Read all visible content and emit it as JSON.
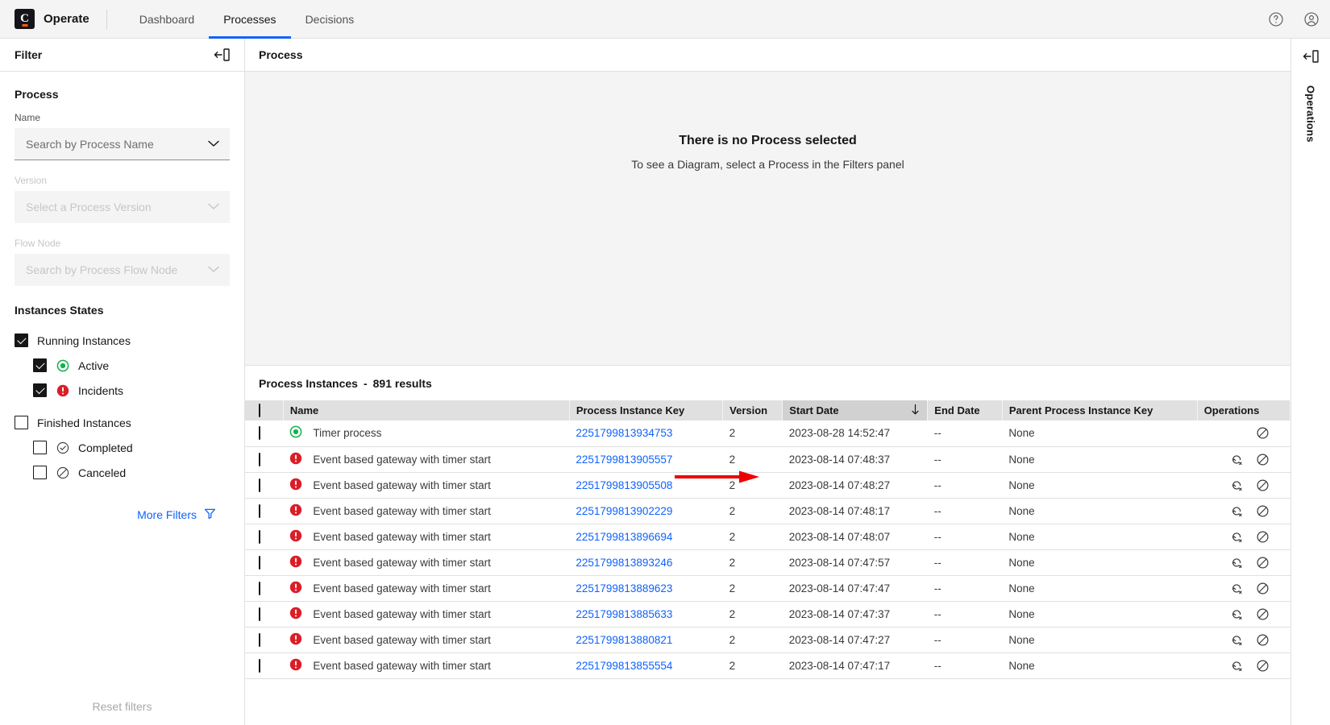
{
  "header": {
    "brand_letter": "C",
    "brand_name": "Operate",
    "nav": [
      {
        "label": "Dashboard",
        "active": false
      },
      {
        "label": "Processes",
        "active": true
      },
      {
        "label": "Decisions",
        "active": false
      }
    ],
    "help_icon": "help-icon",
    "user_icon": "user-avatar-icon"
  },
  "filter_panel": {
    "title": "Filter",
    "collapse_icon": "collapse-panel-icon",
    "process_section": "Process",
    "name_label": "Name",
    "name_placeholder": "Search by Process Name",
    "version_label": "Version",
    "version_placeholder": "Select a Process Version",
    "flow_node_label": "Flow Node",
    "flow_node_placeholder": "Search by Process Flow Node",
    "states_title": "Instances States",
    "states": [
      {
        "label": "Running Instances",
        "checked": true,
        "indent": false,
        "icon": "none"
      },
      {
        "label": "Active",
        "checked": true,
        "indent": true,
        "icon": "active-icon"
      },
      {
        "label": "Incidents",
        "checked": true,
        "indent": true,
        "icon": "incident-icon"
      },
      {
        "label": "Finished Instances",
        "checked": false,
        "indent": false,
        "icon": "none"
      },
      {
        "label": "Completed",
        "checked": false,
        "indent": true,
        "icon": "completed-icon"
      },
      {
        "label": "Canceled",
        "checked": false,
        "indent": true,
        "icon": "canceled-icon"
      }
    ],
    "more_filters": "More Filters",
    "more_filters_icon": "filter-funnel-icon",
    "reset_filters": "Reset filters"
  },
  "process_panel": {
    "title": "Process",
    "empty_title": "There is no Process selected",
    "empty_subtitle": "To see a Diagram, select a Process in the Filters panel"
  },
  "instances": {
    "title": "Process Instances",
    "separator": "-",
    "results": "891 results",
    "columns": [
      {
        "key": "check",
        "label": ""
      },
      {
        "key": "name",
        "label": "Name"
      },
      {
        "key": "processInstanceKey",
        "label": "Process Instance Key"
      },
      {
        "key": "version",
        "label": "Version"
      },
      {
        "key": "startDate",
        "label": "Start Date",
        "sorted": true,
        "sort_dir": "desc"
      },
      {
        "key": "endDate",
        "label": "End Date"
      },
      {
        "key": "parentKey",
        "label": "Parent Process Instance Key"
      },
      {
        "key": "operations",
        "label": "Operations"
      }
    ],
    "rows": [
      {
        "state": "active",
        "name": "Timer process",
        "key": "2251799813934753",
        "version": "2",
        "start": "2023-08-28 14:52:47",
        "end": "--",
        "parent": "None",
        "ops": [
          "cancel"
        ]
      },
      {
        "state": "incident",
        "name": "Event based gateway with timer start",
        "key": "2251799813905557",
        "version": "2",
        "start": "2023-08-14 07:48:37",
        "end": "--",
        "parent": "None",
        "ops": [
          "retry",
          "cancel"
        ]
      },
      {
        "state": "incident",
        "name": "Event based gateway with timer start",
        "key": "2251799813905508",
        "version": "2",
        "start": "2023-08-14 07:48:27",
        "end": "--",
        "parent": "None",
        "ops": [
          "retry",
          "cancel"
        ]
      },
      {
        "state": "incident",
        "name": "Event based gateway with timer start",
        "key": "2251799813902229",
        "version": "2",
        "start": "2023-08-14 07:48:17",
        "end": "--",
        "parent": "None",
        "ops": [
          "retry",
          "cancel"
        ]
      },
      {
        "state": "incident",
        "name": "Event based gateway with timer start",
        "key": "2251799813896694",
        "version": "2",
        "start": "2023-08-14 07:48:07",
        "end": "--",
        "parent": "None",
        "ops": [
          "retry",
          "cancel"
        ]
      },
      {
        "state": "incident",
        "name": "Event based gateway with timer start",
        "key": "2251799813893246",
        "version": "2",
        "start": "2023-08-14 07:47:57",
        "end": "--",
        "parent": "None",
        "ops": [
          "retry",
          "cancel"
        ]
      },
      {
        "state": "incident",
        "name": "Event based gateway with timer start",
        "key": "2251799813889623",
        "version": "2",
        "start": "2023-08-14 07:47:47",
        "end": "--",
        "parent": "None",
        "ops": [
          "retry",
          "cancel"
        ]
      },
      {
        "state": "incident",
        "name": "Event based gateway with timer start",
        "key": "2251799813885633",
        "version": "2",
        "start": "2023-08-14 07:47:37",
        "end": "--",
        "parent": "None",
        "ops": [
          "retry",
          "cancel"
        ]
      },
      {
        "state": "incident",
        "name": "Event based gateway with timer start",
        "key": "2251799813880821",
        "version": "2",
        "start": "2023-08-14 07:47:27",
        "end": "--",
        "parent": "None",
        "ops": [
          "retry",
          "cancel"
        ]
      },
      {
        "state": "incident",
        "name": "Event based gateway with timer start",
        "key": "2251799813855554",
        "version": "2",
        "start": "2023-08-14 07:47:17",
        "end": "--",
        "parent": "None",
        "ops": [
          "retry",
          "cancel"
        ]
      }
    ]
  },
  "right_rail": {
    "collapse_icon": "collapse-panel-icon",
    "label": "Operations"
  },
  "annotation": {
    "type": "arrow",
    "color": "#ef0000",
    "points_to": "first-row-process-instance-key"
  },
  "colors": {
    "accent_blue": "#0f62fe",
    "active_green": "#10b24b",
    "incident_red": "#da1e28",
    "brand_orange": "#fc5d0d",
    "annotation_red": "#ef0000"
  }
}
